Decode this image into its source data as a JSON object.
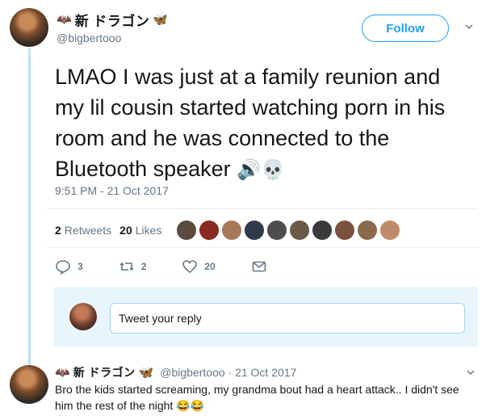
{
  "tweet": {
    "display_name": "新 ドラゴン",
    "handle": "@bigbertooo",
    "follow_label": "Follow",
    "text": "LMAO I was just at a family reunion and my lil cousin started watching porn in his room and he was connected to the Bluetooth speaker",
    "text_emoji": "🔊💀",
    "timestamp": "9:51 PM - 21 Oct 2017",
    "retweets_count": "2",
    "retweets_label": "Retweets",
    "likes_count": "20",
    "likes_label": "Likes",
    "actions": {
      "reply_count": "3",
      "retweet_count": "2",
      "like_count": "20"
    }
  },
  "reply_box": {
    "placeholder": "Tweet your reply"
  },
  "reply": {
    "display_name": "新 ドラゴン",
    "handle_meta": "@bigbertooo · 21 Oct 2017",
    "text": "Bro the kids started screaming, my grandma bout had a heart attack.. I didn't see him the rest of the night",
    "text_emoji": "😂😂"
  },
  "colors": {
    "accent": "#1da1f2",
    "muted": "#657786",
    "thread_line": "#bfe0f5",
    "reply_area_bg": "#e8f5fd"
  },
  "icons": [
    "bat-emoji-icon",
    "dragonfly-emoji-icon",
    "caret-down-icon",
    "reply-icon",
    "retweet-icon",
    "heart-icon",
    "message-icon"
  ]
}
